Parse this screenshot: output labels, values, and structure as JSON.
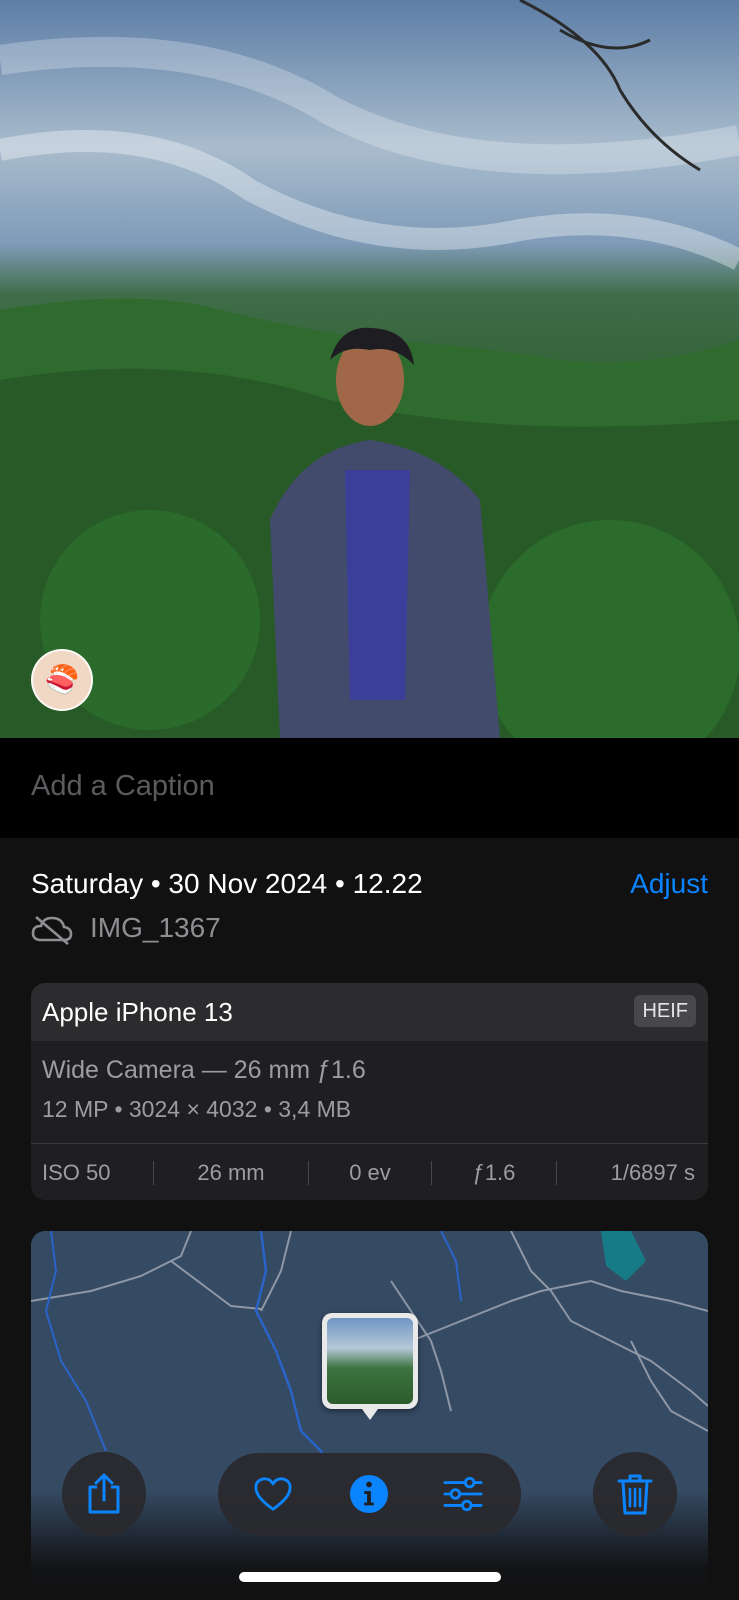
{
  "photo": {
    "sticker_icon": "sushi-emoji"
  },
  "caption": {
    "placeholder": "Add a Caption"
  },
  "info": {
    "datetime": "Saturday • 30 Nov 2024 • 12.22",
    "adjust_label": "Adjust",
    "cloud_icon": "cloud-slash-icon",
    "filename": "IMG_1367"
  },
  "camera_card": {
    "device": "Apple iPhone 13",
    "format_badge": "HEIF",
    "lens": "Wide Camera — 26 mm ƒ1.6",
    "specs": "12 MP • 3024 × 4032 • 3,4 MB",
    "exif": [
      {
        "label": "ISO 50"
      },
      {
        "label": "26 mm"
      },
      {
        "label": "0 ev"
      },
      {
        "label": "ƒ1.6"
      },
      {
        "label": "1/6897 s"
      }
    ]
  },
  "toolbar": {
    "share_icon": "share-icon",
    "favorite_icon": "heart-icon",
    "info_icon": "info-icon",
    "adjust_icon": "sliders-icon",
    "delete_icon": "trash-icon",
    "accent_color": "#0a84ff"
  }
}
